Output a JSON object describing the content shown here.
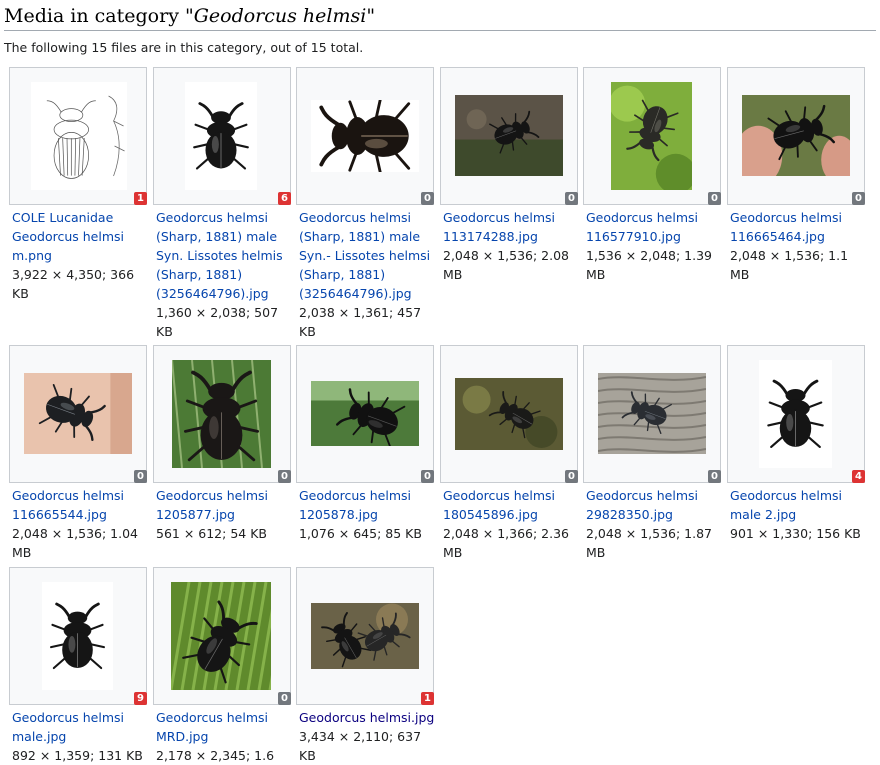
{
  "page": {
    "heading_prefix": "Media in category \"",
    "heading_taxon": "Geodorcus helmsi",
    "heading_suffix": "\"",
    "summary": "The following 15 files are in this category, out of 15 total."
  },
  "colors": {
    "link": "#0645ad",
    "link_visited": "#0b0080",
    "badge_zero": "#72777d",
    "badge_nonzero": "#d33"
  },
  "files": [
    {
      "name": "COLE Lucanidae Geodorcus helmsi m.png",
      "name_lines": [
        "COLE Lucanidae",
        "Geodorcus helmsi",
        "m.png"
      ],
      "meta_lines": [
        "3,922 × 4,350; 366",
        "KB"
      ],
      "badge": "1",
      "thumb": "drawing"
    },
    {
      "name": "Geodorcus helmsi (Sharp, 1881) male Syn. Lissotes helmis (Sharp, 1881) (3256464796).jpg",
      "name_lines": [
        "Geodorcus helmsi",
        "(Sharp, 1881) male",
        "Syn. Lissotes helmis",
        "(Sharp, 1881)",
        "(3256464796).jpg"
      ],
      "meta_lines": [
        "1,360 × 2,038; 507",
        "KB"
      ],
      "badge": "6",
      "thumb": "photo-dorsal-white"
    },
    {
      "name": "Geodorcus helmsi (Sharp, 1881) male Syn.- Lissotes helmsi (Sharp, 1881) (3256464796).jpg",
      "name_lines": [
        "Geodorcus helmsi",
        "(Sharp, 1881) male",
        "Syn.- Lissotes helmsi",
        "(Sharp, 1881)",
        "(3256464796).jpg"
      ],
      "meta_lines": [
        "2,038 × 1,361; 457",
        "KB"
      ],
      "badge": "0",
      "thumb": "photo-lateral-white"
    },
    {
      "name": "Geodorcus helmsi 113174288.jpg",
      "name_lines": [
        "Geodorcus helmsi",
        "113174288.jpg"
      ],
      "meta_lines": [
        "2,048 × 1,536; 2.08",
        "MB"
      ],
      "badge": "0",
      "thumb": "photo-ground"
    },
    {
      "name": "Geodorcus helmsi 116577910.jpg",
      "name_lines": [
        "Geodorcus helmsi",
        "116577910.jpg"
      ],
      "meta_lines": [
        "1,536 × 2,048; 1.39",
        "MB"
      ],
      "badge": "0",
      "thumb": "photo-moss"
    },
    {
      "name": "Geodorcus helmsi 116665464.jpg",
      "name_lines": [
        "Geodorcus helmsi",
        "116665464.jpg"
      ],
      "meta_lines": [
        "2,048 × 1,536; 1.1",
        "MB"
      ],
      "badge": "0",
      "thumb": "photo-fingers"
    },
    {
      "name": "Geodorcus helmsi 116665544.jpg",
      "name_lines": [
        "Geodorcus helmsi",
        "116665544.jpg"
      ],
      "meta_lines": [
        "2,048 × 1,536; 1.04",
        "MB"
      ],
      "badge": "0",
      "thumb": "photo-hand"
    },
    {
      "name": "Geodorcus helmsi 1205877.jpg",
      "name_lines": [
        "Geodorcus helmsi",
        "1205877.jpg"
      ],
      "meta_lines": [
        "561 × 612; 54 KB"
      ],
      "badge": "0",
      "thumb": "photo-fence"
    },
    {
      "name": "Geodorcus helmsi 1205878.jpg",
      "name_lines": [
        "Geodorcus helmsi",
        "1205878.jpg"
      ],
      "meta_lines": [
        "1,076 × 645; 85 KB"
      ],
      "badge": "0",
      "thumb": "photo-ventral"
    },
    {
      "name": "Geodorcus helmsi 180545896.jpg",
      "name_lines": [
        "Geodorcus helmsi",
        "180545896.jpg"
      ],
      "meta_lines": [
        "2,048 × 1,366; 2.36",
        "MB"
      ],
      "badge": "0",
      "thumb": "photo-moss-dark"
    },
    {
      "name": "Geodorcus helmsi 29828350.jpg",
      "name_lines": [
        "Geodorcus helmsi",
        "29828350.jpg"
      ],
      "meta_lines": [
        "2,048 × 1,536; 1.87",
        "MB"
      ],
      "badge": "0",
      "thumb": "photo-wood"
    },
    {
      "name": "Geodorcus helmsi male 2.jpg",
      "name_lines": [
        "Geodorcus helmsi",
        "male 2.jpg"
      ],
      "meta_lines": [
        "901 × 1,330; 156 KB"
      ],
      "badge": "4",
      "thumb": "photo-dorsal-white-2"
    },
    {
      "name": "Geodorcus helmsi male.jpg",
      "name_lines": [
        "Geodorcus helmsi",
        "male.jpg"
      ],
      "meta_lines": [
        "892 × 1,359; 131 KB"
      ],
      "badge": "9",
      "thumb": "photo-dorsal-white-3"
    },
    {
      "name": "Geodorcus helmsi MRD.jpg",
      "name_lines": [
        "Geodorcus helmsi",
        "MRD.jpg"
      ],
      "meta_lines": [
        "2,178 × 2,345; 1.6"
      ],
      "badge": "0",
      "thumb": "photo-grass"
    },
    {
      "name": "Geodorcus helmsi.jpg",
      "name_lines": [
        "Geodorcus helmsi.jpg"
      ],
      "meta_lines": [
        "3,434 × 2,110; 637",
        "KB"
      ],
      "badge": "1",
      "thumb": "photo-pair",
      "visited": true
    }
  ]
}
